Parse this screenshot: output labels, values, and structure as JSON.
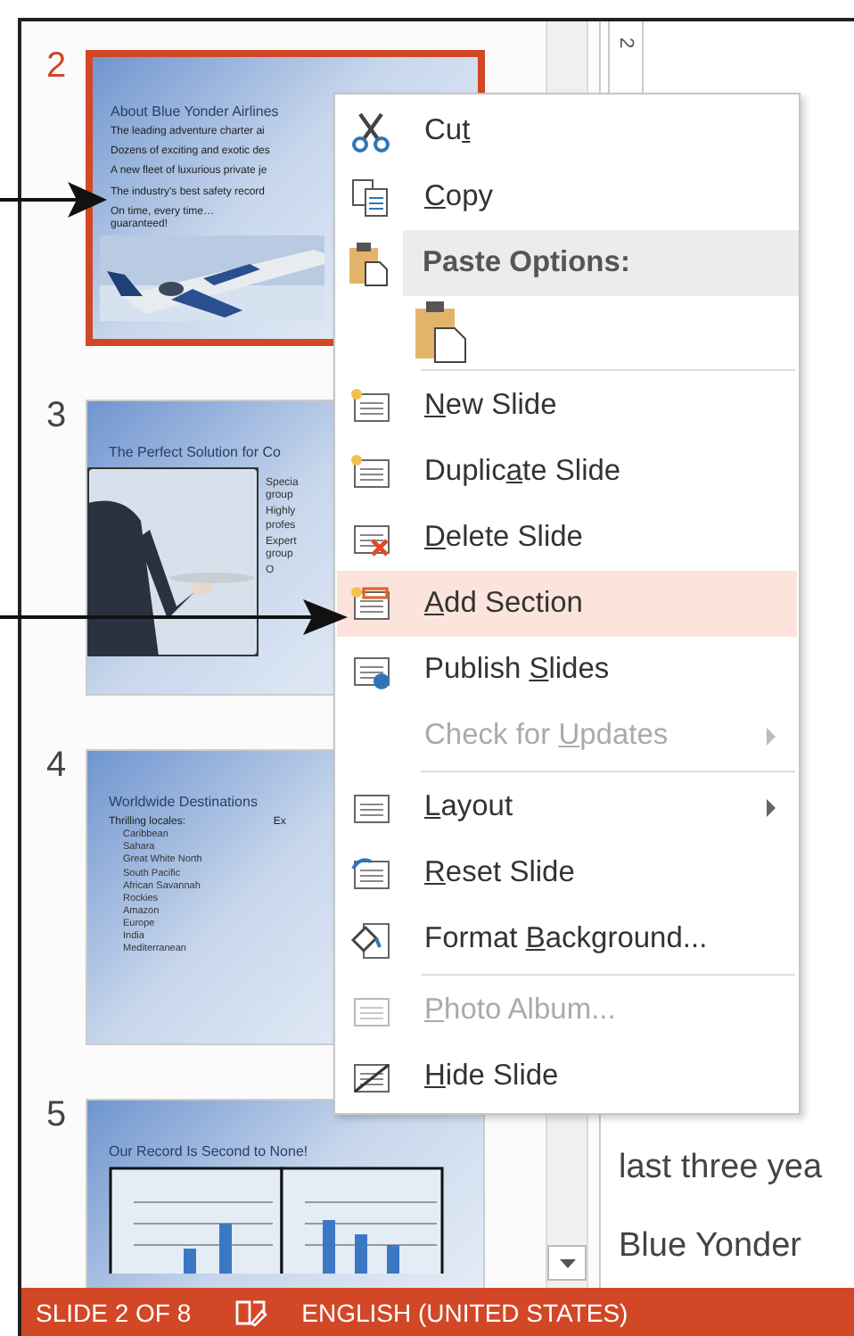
{
  "slides": [
    {
      "number": "2",
      "selected": true,
      "kind": "text-photo",
      "title": "About Blue Yonder Airlines",
      "bullets": [
        "The leading adventure charter ai",
        "Dozens of exciting and exotic des",
        "A new fleet of luxurious private je",
        "The industry's best safety record",
        "On time, every time…\nguaranteed!"
      ]
    },
    {
      "number": "3",
      "selected": false,
      "kind": "photo-text",
      "title": "The Perfect Solution for Co",
      "bullets": [
        "Specia\ngroup",
        "Highly\nprofes",
        "Expert\ngroup",
        "O"
      ]
    },
    {
      "number": "4",
      "selected": false,
      "kind": "two-lists",
      "title": "Worldwide Destinations",
      "bullets": [
        "Thrilling locales:"
      ],
      "subitems": [
        "Caribbean",
        "Sahara",
        "Great White North",
        "South Pacific",
        "African Savannah",
        "Rockies",
        "Amazon",
        "Europe",
        "India",
        "Mediterranean"
      ],
      "column_2": "Ex"
    },
    {
      "number": "5",
      "selected": false,
      "kind": "charts",
      "title": "Our Record Is Second to None!"
    }
  ],
  "ruler": {
    "label": "2"
  },
  "notes": {
    "lines": [
      "last three yea",
      "Blue Yonder"
    ]
  },
  "context_menu": {
    "items": [
      {
        "kind": "item",
        "before": "Cu",
        "key": "t",
        "selected": false,
        "disabled": false,
        "submenu": false
      },
      {
        "kind": "item",
        "key": "C",
        "after": "opy",
        "selected": false,
        "disabled": false,
        "submenu": false
      },
      {
        "kind": "header",
        "label": "Paste Options:"
      },
      {
        "kind": "paste"
      },
      {
        "kind": "separator"
      },
      {
        "kind": "item",
        "key": "N",
        "after": "ew Slide",
        "selected": false,
        "disabled": false,
        "submenu": false
      },
      {
        "kind": "item",
        "before": "Duplic",
        "key": "a",
        "after": "te Slide",
        "selected": false,
        "disabled": false,
        "submenu": false
      },
      {
        "kind": "item",
        "key": "D",
        "after": "elete Slide",
        "selected": false,
        "disabled": false,
        "submenu": false
      },
      {
        "kind": "item",
        "key": "A",
        "after": "dd Section",
        "selected": true,
        "disabled": false,
        "submenu": false
      },
      {
        "kind": "item",
        "before": "Publish ",
        "key": "S",
        "after": "lides",
        "selected": false,
        "disabled": false,
        "submenu": false
      },
      {
        "kind": "item",
        "before": "Check for ",
        "key": "U",
        "after": "pdates",
        "selected": false,
        "disabled": true,
        "submenu": true
      },
      {
        "kind": "separator"
      },
      {
        "kind": "item",
        "key": "L",
        "after": "ayout",
        "selected": false,
        "disabled": false,
        "submenu": true
      },
      {
        "kind": "item",
        "key": "R",
        "after": "eset Slide",
        "selected": false,
        "disabled": false,
        "submenu": false
      },
      {
        "kind": "item",
        "before": "Format ",
        "key": "B",
        "after": "ackground...",
        "selected": false,
        "disabled": false,
        "submenu": false
      },
      {
        "kind": "separator"
      },
      {
        "kind": "item",
        "key": "P",
        "after": "hoto Album...",
        "selected": false,
        "disabled": true,
        "submenu": false
      },
      {
        "kind": "item",
        "key": "H",
        "after": "ide Slide",
        "selected": false,
        "disabled": false,
        "submenu": false
      }
    ]
  },
  "status_bar": {
    "slide": "SLIDE 2 OF 8",
    "language": "ENGLISH (UNITED STATES)"
  }
}
